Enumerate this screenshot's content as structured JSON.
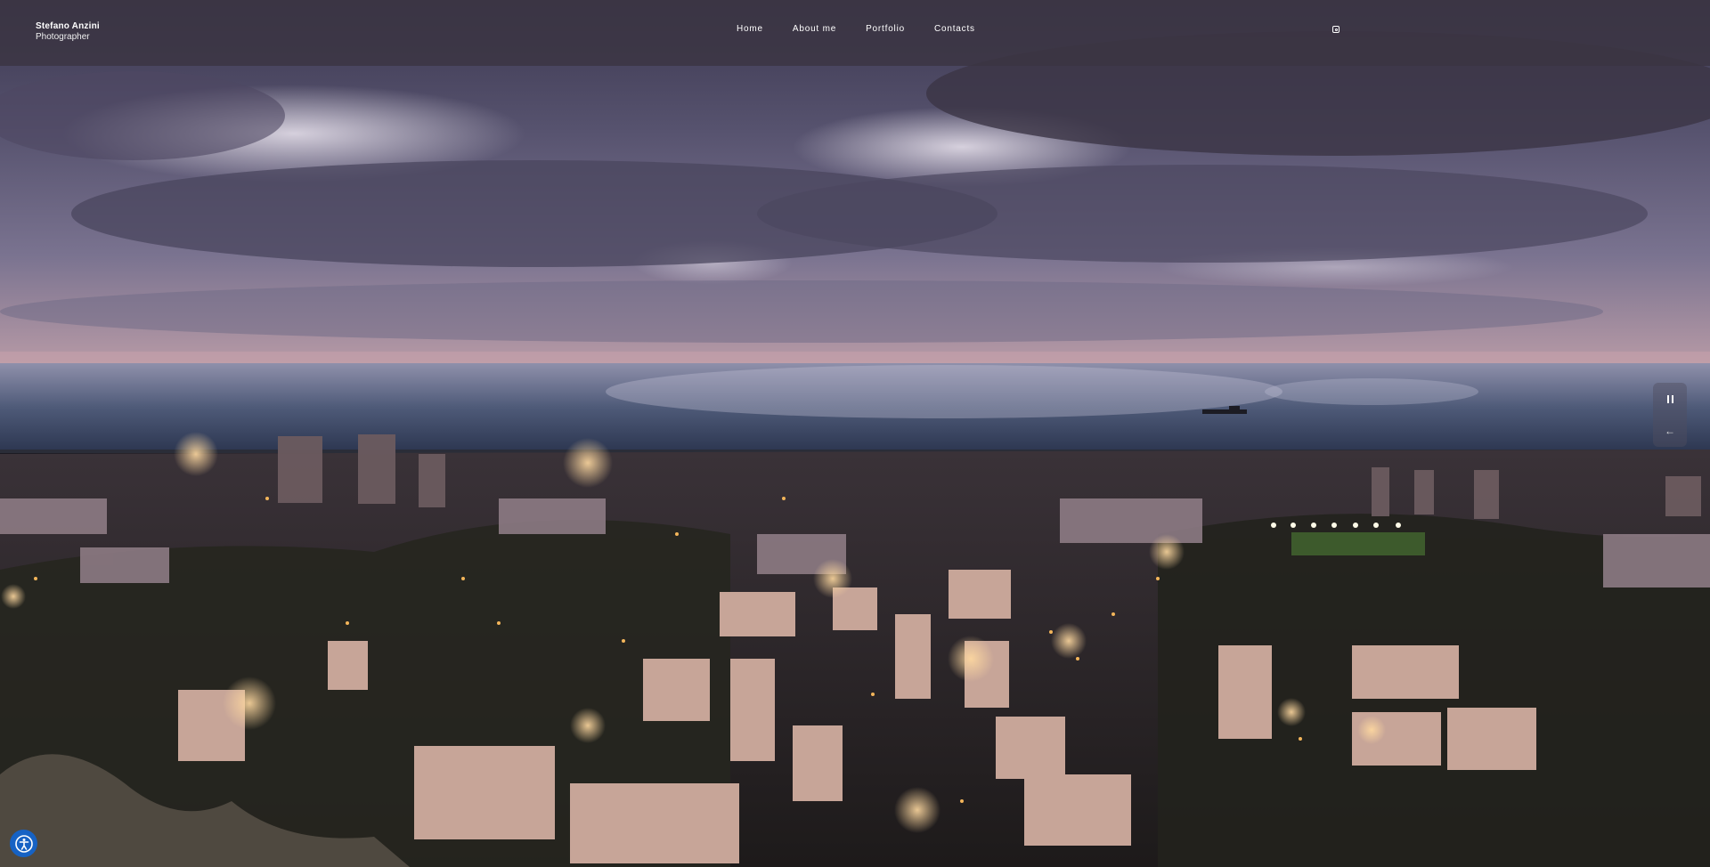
{
  "brand": {
    "name": "Stefano Anzini",
    "role": "Photographer"
  },
  "nav": {
    "items": [
      {
        "label": "Home"
      },
      {
        "label": "About me"
      },
      {
        "label": "Portfolio"
      },
      {
        "label": "Contacts"
      }
    ]
  },
  "social": {
    "icon": "instagram-icon"
  },
  "slider": {
    "pause_icon": "pause-icon",
    "prev_icon": "arrow-left-icon",
    "prev_glyph": "←"
  },
  "accessibility": {
    "icon": "accessibility-icon"
  },
  "colors": {
    "navbar_bg": "#3a3442",
    "accessibility_bg": "#1662c4",
    "sky_top": "#3c3850",
    "sea": "#3a4a66",
    "city_lights": "#f3b55a"
  }
}
